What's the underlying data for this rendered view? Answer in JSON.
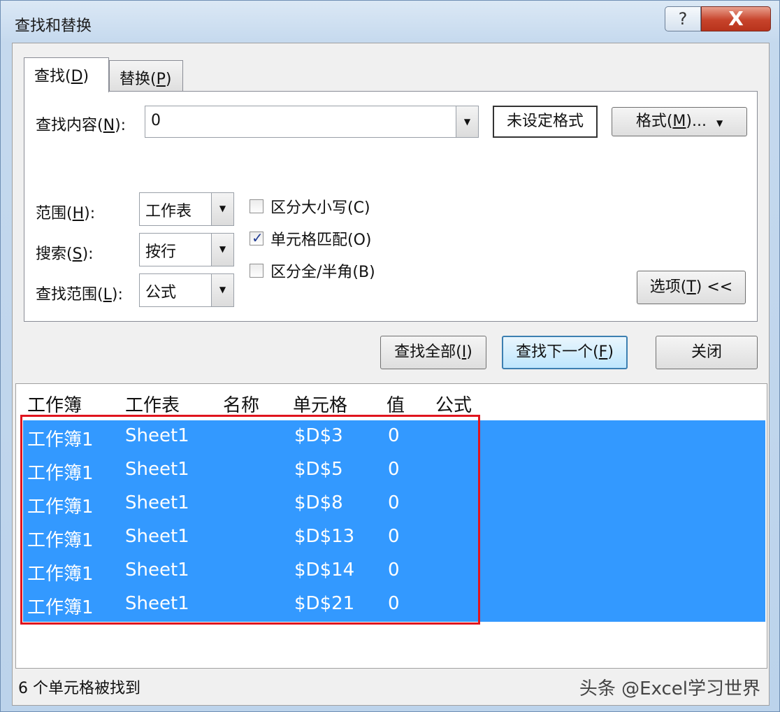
{
  "window": {
    "title": "查找和替换",
    "help_label": "?",
    "close_label": "X"
  },
  "tabs": [
    {
      "label": "查找(",
      "hot": "D",
      "tail": ")"
    },
    {
      "label": "替换(",
      "hot": "P",
      "tail": ")"
    }
  ],
  "find": {
    "label_pre": "查找内容(",
    "label_hot": "N",
    "label_post": "):",
    "value": "0",
    "format_status": "未设定格式",
    "format_button_pre": "格式(",
    "format_button_hot": "M",
    "format_button_post": ")..."
  },
  "scope": {
    "label_pre": "范围(",
    "label_hot": "H",
    "label_post": "):",
    "value": "工作表"
  },
  "search": {
    "label_pre": "搜索(",
    "label_hot": "S",
    "label_post": "):",
    "value": "按行"
  },
  "lookin": {
    "label_pre": "查找范围(",
    "label_hot": "L",
    "label_post": "):",
    "value": "公式"
  },
  "options": [
    {
      "label": "区分大小写(C)",
      "checked": false
    },
    {
      "label": "单元格匹配(O)",
      "checked": true
    },
    {
      "label": "区分全/半角(B)",
      "checked": false
    }
  ],
  "options_button": {
    "pre": "选项(",
    "hot": "T",
    "post": ") <<"
  },
  "actions": {
    "find_all_pre": "查找全部(",
    "find_all_hot": "I",
    "find_all_post": ")",
    "find_next_pre": "查找下一个(",
    "find_next_hot": "F",
    "find_next_post": ")",
    "close": "关闭"
  },
  "results": {
    "headers": [
      "工作簿",
      "工作表",
      "名称",
      "单元格",
      "值",
      "公式"
    ],
    "rows": [
      {
        "workbook": "工作簿1",
        "sheet": "Sheet1",
        "name": "",
        "cell": "$D$3",
        "value": "0",
        "formula": ""
      },
      {
        "workbook": "工作簿1",
        "sheet": "Sheet1",
        "name": "",
        "cell": "$D$5",
        "value": "0",
        "formula": ""
      },
      {
        "workbook": "工作簿1",
        "sheet": "Sheet1",
        "name": "",
        "cell": "$D$8",
        "value": "0",
        "formula": ""
      },
      {
        "workbook": "工作簿1",
        "sheet": "Sheet1",
        "name": "",
        "cell": "$D$13",
        "value": "0",
        "formula": ""
      },
      {
        "workbook": "工作簿1",
        "sheet": "Sheet1",
        "name": "",
        "cell": "$D$14",
        "value": "0",
        "formula": ""
      },
      {
        "workbook": "工作簿1",
        "sheet": "Sheet1",
        "name": "",
        "cell": "$D$21",
        "value": "0",
        "formula": ""
      }
    ]
  },
  "status": "6 个单元格被找到",
  "watermark": "头条 @Excel学习世界",
  "colors": {
    "selection": "#3399ff",
    "highlight_border": "#e0141e"
  }
}
